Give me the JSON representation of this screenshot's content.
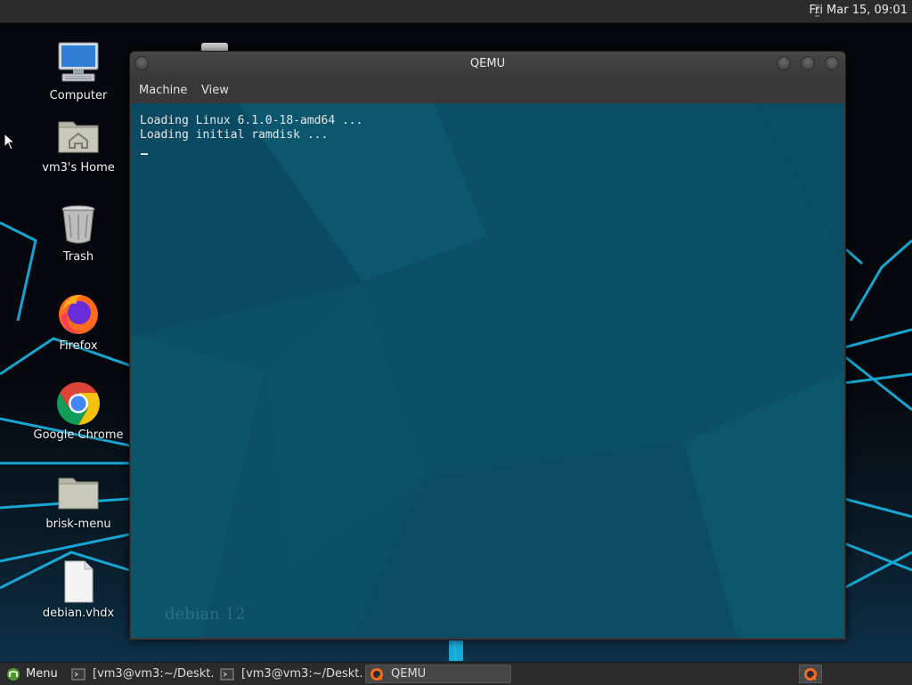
{
  "top_panel": {
    "clock": "Fri Mar 15, 09:01"
  },
  "desktop": {
    "icons": [
      {
        "label": "Computer",
        "icon": "computer-icon"
      },
      {
        "label": "vm3's Home",
        "icon": "home-folder-icon"
      },
      {
        "label": "Trash",
        "icon": "trash-icon"
      },
      {
        "label": "Firefox",
        "icon": "firefox-icon"
      },
      {
        "label": "Google Chrome",
        "icon": "chrome-icon"
      },
      {
        "label": "brisk-menu",
        "icon": "folder-icon"
      },
      {
        "label": "debian.vhdx",
        "icon": "file-icon"
      }
    ]
  },
  "qemu_window": {
    "title": "QEMU",
    "menu": [
      "Machine",
      "View"
    ],
    "console_lines": [
      "Loading Linux 6.1.0-18-amd64 ...",
      "Loading initial ramdisk ..."
    ],
    "watermark": "debian 12"
  },
  "taskbar": {
    "menu_label": "Menu",
    "tasks": [
      {
        "label": "[vm3@vm3:~/Deskt...",
        "icon": "terminal-icon",
        "active": false
      },
      {
        "label": "[vm3@vm3:~/Deskt...",
        "icon": "terminal-icon",
        "active": false
      },
      {
        "label": "QEMU",
        "icon": "qemu-icon",
        "active": true
      }
    ]
  },
  "colors": {
    "panel": "#2b2b2b",
    "guest_background": "#0b4e66",
    "wallpaper_accent": "#1ab6e6"
  }
}
